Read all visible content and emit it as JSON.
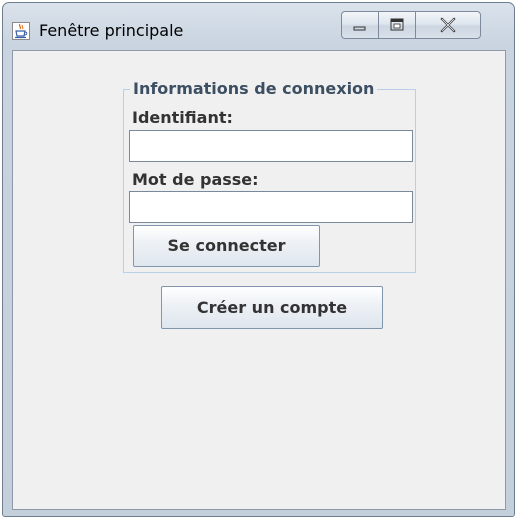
{
  "window": {
    "title": "Fenêtre principale",
    "icon": "java-cup-icon",
    "controls": [
      "minimize-icon",
      "maximize-icon",
      "close-icon"
    ]
  },
  "login_panel": {
    "title": "Informations de connexion",
    "username_label": "Identifiant:",
    "username_value": "",
    "password_label": "Mot de passe:",
    "password_value": "",
    "connect_button": "Se connecter"
  },
  "create_account_button": "Créer un compte",
  "colors": {
    "client_background": "#f0f0f0",
    "group_border": "#b8cfe5",
    "group_title": "#3d4f62",
    "label_text": "#333333"
  }
}
